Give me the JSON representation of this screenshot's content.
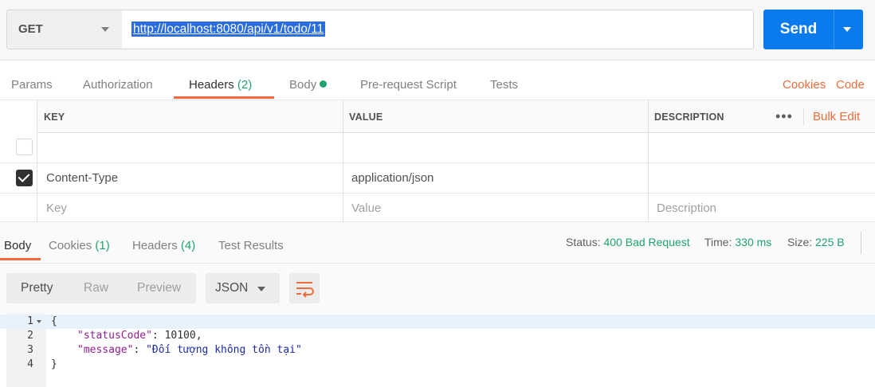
{
  "request": {
    "method": "GET",
    "url": "http://localhost:8080/api/v1/todo/11",
    "send_label": "Send"
  },
  "req_tabs": {
    "params": "Params",
    "authorization": "Authorization",
    "headers": "Headers",
    "headers_count": "(2)",
    "body": "Body",
    "prerequest": "Pre-request Script",
    "tests": "Tests",
    "cookies": "Cookies",
    "code": "Code"
  },
  "headers_table": {
    "col_key": "KEY",
    "col_value": "VALUE",
    "col_description": "DESCRIPTION",
    "more": "•••",
    "bulk_edit": "Bulk Edit",
    "rows": [
      {
        "key": "",
        "value": "",
        "description": "",
        "checked": false
      },
      {
        "key": "Content-Type",
        "value": "application/json",
        "description": "",
        "checked": true
      }
    ],
    "placeholder": {
      "key": "Key",
      "value": "Value",
      "description": "Description"
    }
  },
  "response": {
    "tabs": {
      "body": "Body",
      "cookies": "Cookies",
      "cookies_count": "(1)",
      "headers": "Headers",
      "headers_count": "(4)",
      "test_results": "Test Results"
    },
    "status_label": "Status:",
    "status_value": "400 Bad Request",
    "time_label": "Time:",
    "time_value": "330 ms",
    "size_label": "Size:",
    "size_value": "225 B",
    "views": {
      "pretty": "Pretty",
      "raw": "Raw",
      "preview": "Preview"
    },
    "format": "JSON",
    "lines": [
      {
        "n": "1",
        "text": "{"
      },
      {
        "n": "2",
        "key": "\"statusCode\"",
        "sep": ": ",
        "val": "10100",
        "tail": ","
      },
      {
        "n": "3",
        "key": "\"message\"",
        "sep": ": ",
        "str": "\"Đối tượng không tồn tại\""
      },
      {
        "n": "4",
        "text": "}"
      }
    ]
  },
  "colors": {
    "accent": "#f26b3a",
    "send": "#097bed",
    "success": "#1fa36c"
  }
}
